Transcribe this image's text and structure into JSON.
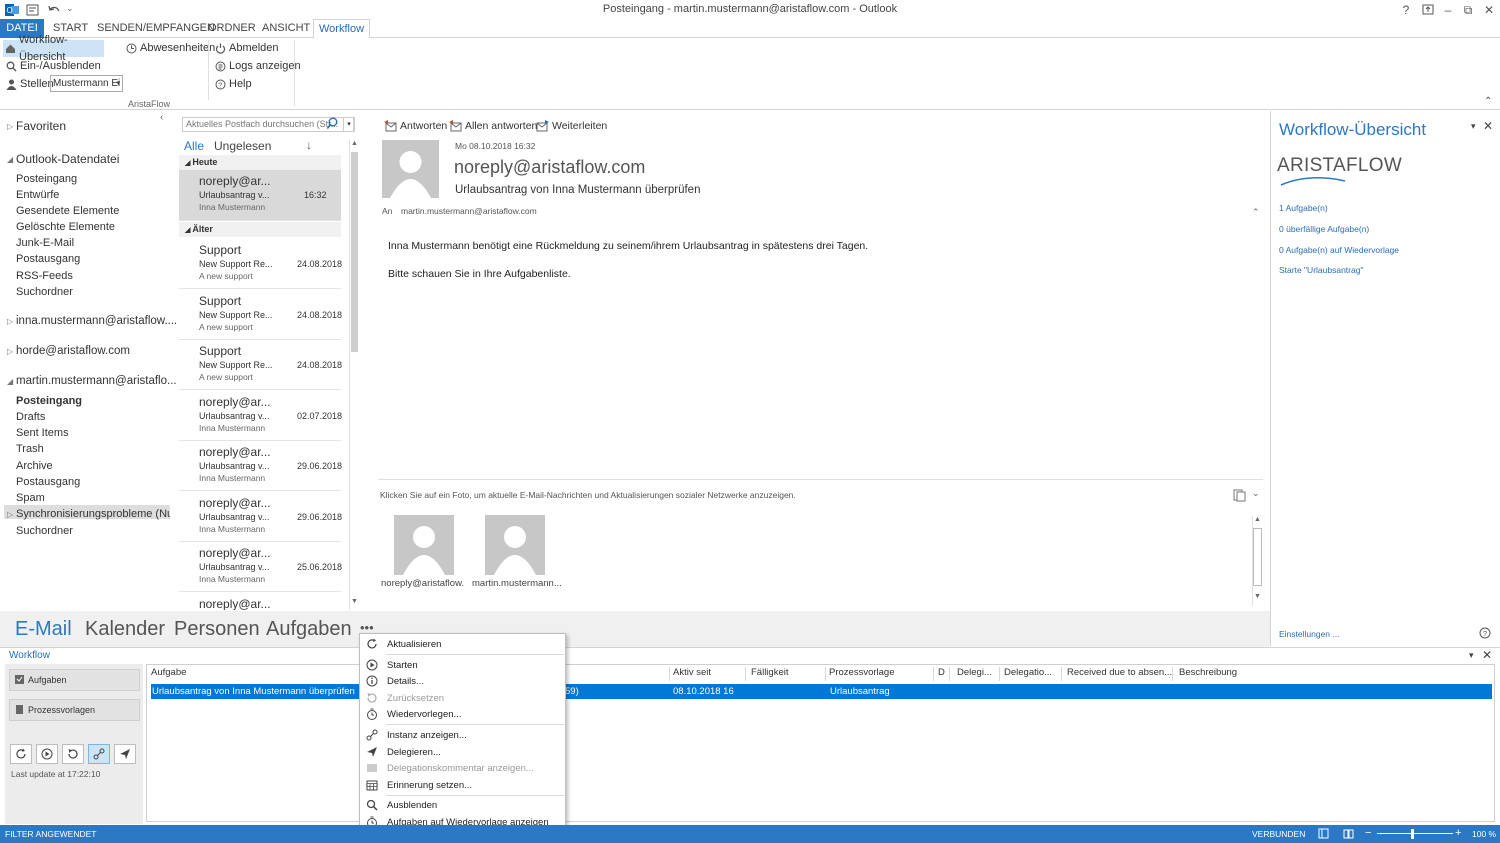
{
  "window": {
    "title": "Posteingang - martin.mustermann@aristaflow.com - Outlook",
    "help": "?",
    "min": "–",
    "max": "⧉",
    "close": "✕"
  },
  "tabs": [
    "DATEI",
    "START",
    "SENDEN/EMPFANGEN",
    "ORDNER",
    "ANSICHT",
    "Workflow"
  ],
  "ribbon": {
    "workflow_overview": "Workflow-Übersicht",
    "toggle": "Ein-/Ausblenden",
    "stellen": "Stellen",
    "stellen_value": "Mustermann Ei",
    "abwesenheiten": "Abwesenheiten",
    "abmelden": "Abmelden",
    "logs": "Logs anzeigen",
    "help": "Help",
    "group": "AristaFlow"
  },
  "nav": {
    "favoriten": "Favoriten",
    "datafile": "Outlook-Datendatei",
    "datafile_items": [
      "Posteingang",
      "Entwürfe",
      "Gesendete Elemente",
      "Gelöschte Elemente",
      "Junk-E-Mail",
      "Postausgang",
      "RSS-Feeds",
      "Suchordner"
    ],
    "account1": "inna.mustermann@aristaflow....",
    "account2": "horde@aristaflow.com",
    "account3": "martin.mustermann@aristaflo...",
    "account3_items": [
      "Posteingang",
      "Drafts",
      "Sent Items",
      "Trash",
      "Archive",
      "Postausgang",
      "Spam",
      "Synchronisierungsprobleme (Nur d...",
      "Suchordner"
    ]
  },
  "list": {
    "search_placeholder": "Aktuelles Postfach durchsuchen (Str...",
    "filter_all": "Alle",
    "filter_unread": "Ungelesen",
    "group_today": "Heute",
    "group_older": "Älter",
    "items": [
      {
        "from": "noreply@ar...",
        "subject": "Urlaubsantrag v...",
        "date": "16:32",
        "snippet": "Inna Mustermann"
      },
      {
        "from": "Support",
        "subject": "New Support Re...",
        "date": "24.08.2018",
        "snippet": "A new support"
      },
      {
        "from": "Support",
        "subject": "New Support Re...",
        "date": "24.08.2018",
        "snippet": "A new support"
      },
      {
        "from": "Support",
        "subject": "New Support Re...",
        "date": "24.08.2018",
        "snippet": "A new support"
      },
      {
        "from": "noreply@ar...",
        "subject": "Urlaubsantrag v...",
        "date": "02.07.2018",
        "snippet": "Inna Mustermann"
      },
      {
        "from": "noreply@ar...",
        "subject": "Urlaubsantrag v...",
        "date": "29.06.2018",
        "snippet": "Inna Mustermann"
      },
      {
        "from": "noreply@ar...",
        "subject": "Urlaubsantrag v...",
        "date": "29.06.2018",
        "snippet": "Inna Mustermann"
      },
      {
        "from": "noreply@ar...",
        "subject": "Urlaubsantrag v...",
        "date": "25.06.2018",
        "snippet": "Inna Mustermann"
      },
      {
        "from": "noreply@ar...",
        "subject": "",
        "date": "",
        "snippet": ""
      }
    ]
  },
  "reading": {
    "reply": "Antworten",
    "reply_all": "Allen antworten",
    "forward": "Weiterleiten",
    "date": "Mo 08.10.2018 16:32",
    "sender": "noreply@aristaflow.com",
    "subject": "Urlaubsantrag von Inna Mustermann überprüfen",
    "to_label": "An",
    "to": "martin.mustermann@aristaflow.com",
    "body1": "Inna Mustermann benötigt eine Rückmeldung zu seinem/ihrem Urlaubsantrag in spätestens drei Tagen.",
    "body2": "Bitte schauen Sie in Ihre Aufgabenliste.",
    "social": "Klicken Sie auf ein Foto, um aktuelle E-Mail-Nachrichten und Aktualisierungen sozialer Netzwerke anzuzeigen.",
    "person1": "noreply@aristaflow.",
    "person2": "martin.mustermann..."
  },
  "taskpane": {
    "title": "Workflow-Übersicht",
    "logo": "ARISTAFLOW",
    "links": [
      "1 Aufgabe(n)",
      "0 überfällige Aufgabe(n)",
      "0 Aufgabe(n) auf Wiedervorlage",
      "Starte \"Urlaubsantrag\""
    ],
    "settings": "Einstellungen ..."
  },
  "bottomnav": [
    "E-Mail",
    "Kalender",
    "Personen",
    "Aufgaben",
    "•••"
  ],
  "workflow": {
    "title": "Workflow",
    "btn_tasks": "Aufgaben",
    "btn_templates": "Prozessvorlagen",
    "last_update": "Last update at 17:22:10",
    "columns": [
      "Aufgabe",
      "Aktiv seit",
      "Fälligkeit",
      "Prozessvorlage",
      "D",
      "Delegi...",
      "Delegatio...",
      "Received due to absen...",
      "Beschreibung"
    ],
    "row": {
      "task": "Urlaubsantrag von Inna Mustermann überprüfen",
      "hidden_fragment": "59)",
      "active": "08.10.2018 16",
      "template": "Urlaubsantrag"
    }
  },
  "menu": [
    "Aktualisieren",
    "Starten",
    "Details...",
    "Zurücksetzen",
    "Wiedervorlegen...",
    "Instanz anzeigen...",
    "Delegieren...",
    "Delegationskommentar anzeigen...",
    "Erinnerung setzen...",
    "Ausblenden",
    "Aufgaben auf Wiedervorlage anzeigen"
  ],
  "status": {
    "filter": "FILTER ANGEWENDET",
    "connected": "VERBUNDEN",
    "zoom": "100 %"
  },
  "colors": {
    "accent": "#2b78c5",
    "selection": "#0078d7",
    "link": "#2b6cb3"
  }
}
